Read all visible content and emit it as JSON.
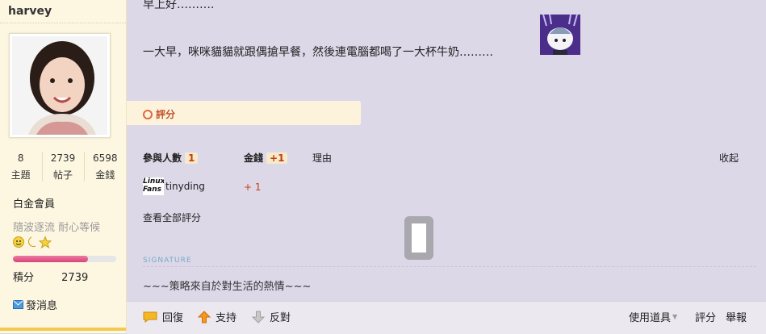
{
  "author": {
    "username": "harvey",
    "stats": [
      {
        "value": "8",
        "label": "主題"
      },
      {
        "value": "2739",
        "label": "帖子"
      },
      {
        "value": "6598",
        "label": "金錢"
      }
    ],
    "rank": "白金會員",
    "motto": "隨波逐流 耐心等候",
    "level_progress": 0.73,
    "points_label": "積分",
    "points_value": "2739",
    "pm_label": "發消息"
  },
  "post": {
    "line1": "早上好……….",
    "line2": "一大早，咪咪貓貓就跟偶搶早餐，然後連電腦都喝了一大杯牛奶………",
    "rating_tab": "評分",
    "rating": {
      "participants_label": "參與人數",
      "participants_count": "1",
      "money_label": "金錢",
      "money_total": "+1",
      "reason_label": "理由",
      "collapse_label": "收起",
      "rows": [
        {
          "user": "tinyding",
          "money": "+ 1",
          "avatar_text": "Linux Fans"
        }
      ],
      "view_all": "查看全部評分"
    },
    "signature_label": "SIGNATURE",
    "signature": "~~~策略來自於對生活的熱情~~~"
  },
  "actions": {
    "reply": "回復",
    "support": "支持",
    "oppose": "反對",
    "tools": "使用道具",
    "rate": "評分",
    "report": "舉報"
  }
}
